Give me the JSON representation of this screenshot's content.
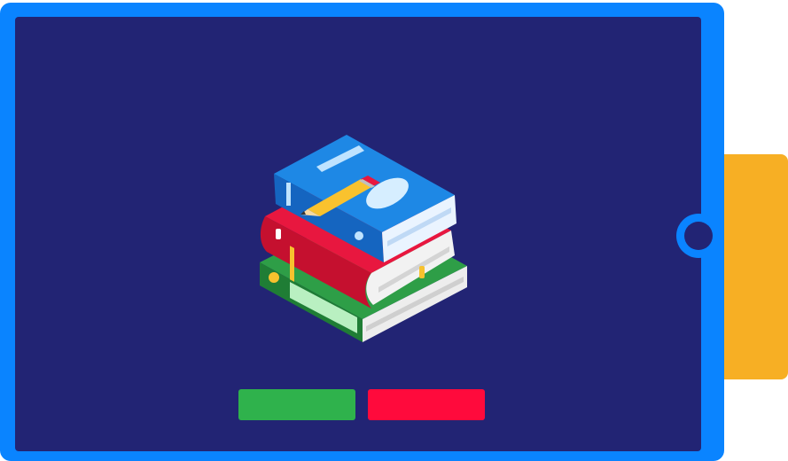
{
  "colors": {
    "device_frame": "#0A84FF",
    "screen": "#222474",
    "side_tab": "#F7AF24",
    "confirm_button": "#2FB24C",
    "cancel_button": "#FF0A3C",
    "book_blue": "#1E88E5",
    "book_red": "#E8173F",
    "book_green": "#2E9E47",
    "pencil": "#F9C22E"
  },
  "illustration": {
    "icon": "stack-of-books-with-pencil-icon"
  },
  "buttons": {
    "confirm_label": "",
    "cancel_label": ""
  }
}
